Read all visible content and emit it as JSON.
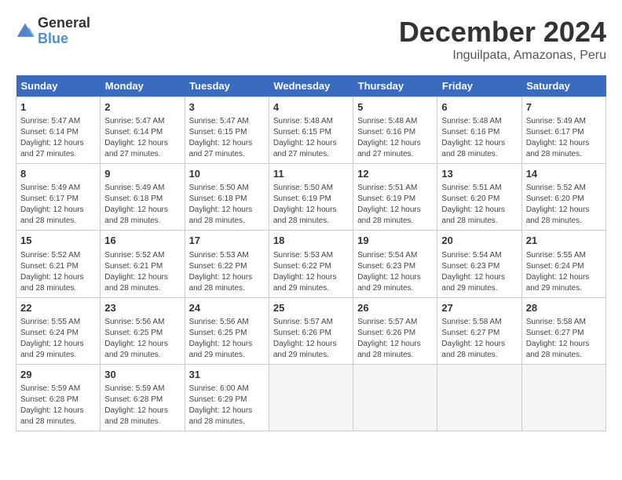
{
  "header": {
    "logo_general": "General",
    "logo_blue": "Blue",
    "title": "December 2024",
    "subtitle": "Inguilpata, Amazonas, Peru"
  },
  "days_of_week": [
    "Sunday",
    "Monday",
    "Tuesday",
    "Wednesday",
    "Thursday",
    "Friday",
    "Saturday"
  ],
  "weeks": [
    [
      {
        "day": "1",
        "info": "Sunrise: 5:47 AM\nSunset: 6:14 PM\nDaylight: 12 hours and 27 minutes."
      },
      {
        "day": "2",
        "info": "Sunrise: 5:47 AM\nSunset: 6:14 PM\nDaylight: 12 hours and 27 minutes."
      },
      {
        "day": "3",
        "info": "Sunrise: 5:47 AM\nSunset: 6:15 PM\nDaylight: 12 hours and 27 minutes."
      },
      {
        "day": "4",
        "info": "Sunrise: 5:48 AM\nSunset: 6:15 PM\nDaylight: 12 hours and 27 minutes."
      },
      {
        "day": "5",
        "info": "Sunrise: 5:48 AM\nSunset: 6:16 PM\nDaylight: 12 hours and 27 minutes."
      },
      {
        "day": "6",
        "info": "Sunrise: 5:48 AM\nSunset: 6:16 PM\nDaylight: 12 hours and 28 minutes."
      },
      {
        "day": "7",
        "info": "Sunrise: 5:49 AM\nSunset: 6:17 PM\nDaylight: 12 hours and 28 minutes."
      }
    ],
    [
      {
        "day": "8",
        "info": "Sunrise: 5:49 AM\nSunset: 6:17 PM\nDaylight: 12 hours and 28 minutes."
      },
      {
        "day": "9",
        "info": "Sunrise: 5:49 AM\nSunset: 6:18 PM\nDaylight: 12 hours and 28 minutes."
      },
      {
        "day": "10",
        "info": "Sunrise: 5:50 AM\nSunset: 6:18 PM\nDaylight: 12 hours and 28 minutes."
      },
      {
        "day": "11",
        "info": "Sunrise: 5:50 AM\nSunset: 6:19 PM\nDaylight: 12 hours and 28 minutes."
      },
      {
        "day": "12",
        "info": "Sunrise: 5:51 AM\nSunset: 6:19 PM\nDaylight: 12 hours and 28 minutes."
      },
      {
        "day": "13",
        "info": "Sunrise: 5:51 AM\nSunset: 6:20 PM\nDaylight: 12 hours and 28 minutes."
      },
      {
        "day": "14",
        "info": "Sunrise: 5:52 AM\nSunset: 6:20 PM\nDaylight: 12 hours and 28 minutes."
      }
    ],
    [
      {
        "day": "15",
        "info": "Sunrise: 5:52 AM\nSunset: 6:21 PM\nDaylight: 12 hours and 28 minutes."
      },
      {
        "day": "16",
        "info": "Sunrise: 5:52 AM\nSunset: 6:21 PM\nDaylight: 12 hours and 28 minutes."
      },
      {
        "day": "17",
        "info": "Sunrise: 5:53 AM\nSunset: 6:22 PM\nDaylight: 12 hours and 28 minutes."
      },
      {
        "day": "18",
        "info": "Sunrise: 5:53 AM\nSunset: 6:22 PM\nDaylight: 12 hours and 29 minutes."
      },
      {
        "day": "19",
        "info": "Sunrise: 5:54 AM\nSunset: 6:23 PM\nDaylight: 12 hours and 29 minutes."
      },
      {
        "day": "20",
        "info": "Sunrise: 5:54 AM\nSunset: 6:23 PM\nDaylight: 12 hours and 29 minutes."
      },
      {
        "day": "21",
        "info": "Sunrise: 5:55 AM\nSunset: 6:24 PM\nDaylight: 12 hours and 29 minutes."
      }
    ],
    [
      {
        "day": "22",
        "info": "Sunrise: 5:55 AM\nSunset: 6:24 PM\nDaylight: 12 hours and 29 minutes."
      },
      {
        "day": "23",
        "info": "Sunrise: 5:56 AM\nSunset: 6:25 PM\nDaylight: 12 hours and 29 minutes."
      },
      {
        "day": "24",
        "info": "Sunrise: 5:56 AM\nSunset: 6:25 PM\nDaylight: 12 hours and 29 minutes."
      },
      {
        "day": "25",
        "info": "Sunrise: 5:57 AM\nSunset: 6:26 PM\nDaylight: 12 hours and 29 minutes."
      },
      {
        "day": "26",
        "info": "Sunrise: 5:57 AM\nSunset: 6:26 PM\nDaylight: 12 hours and 28 minutes."
      },
      {
        "day": "27",
        "info": "Sunrise: 5:58 AM\nSunset: 6:27 PM\nDaylight: 12 hours and 28 minutes."
      },
      {
        "day": "28",
        "info": "Sunrise: 5:58 AM\nSunset: 6:27 PM\nDaylight: 12 hours and 28 minutes."
      }
    ],
    [
      {
        "day": "29",
        "info": "Sunrise: 5:59 AM\nSunset: 6:28 PM\nDaylight: 12 hours and 28 minutes."
      },
      {
        "day": "30",
        "info": "Sunrise: 5:59 AM\nSunset: 6:28 PM\nDaylight: 12 hours and 28 minutes."
      },
      {
        "day": "31",
        "info": "Sunrise: 6:00 AM\nSunset: 6:29 PM\nDaylight: 12 hours and 28 minutes."
      },
      {
        "day": "",
        "info": ""
      },
      {
        "day": "",
        "info": ""
      },
      {
        "day": "",
        "info": ""
      },
      {
        "day": "",
        "info": ""
      }
    ]
  ]
}
